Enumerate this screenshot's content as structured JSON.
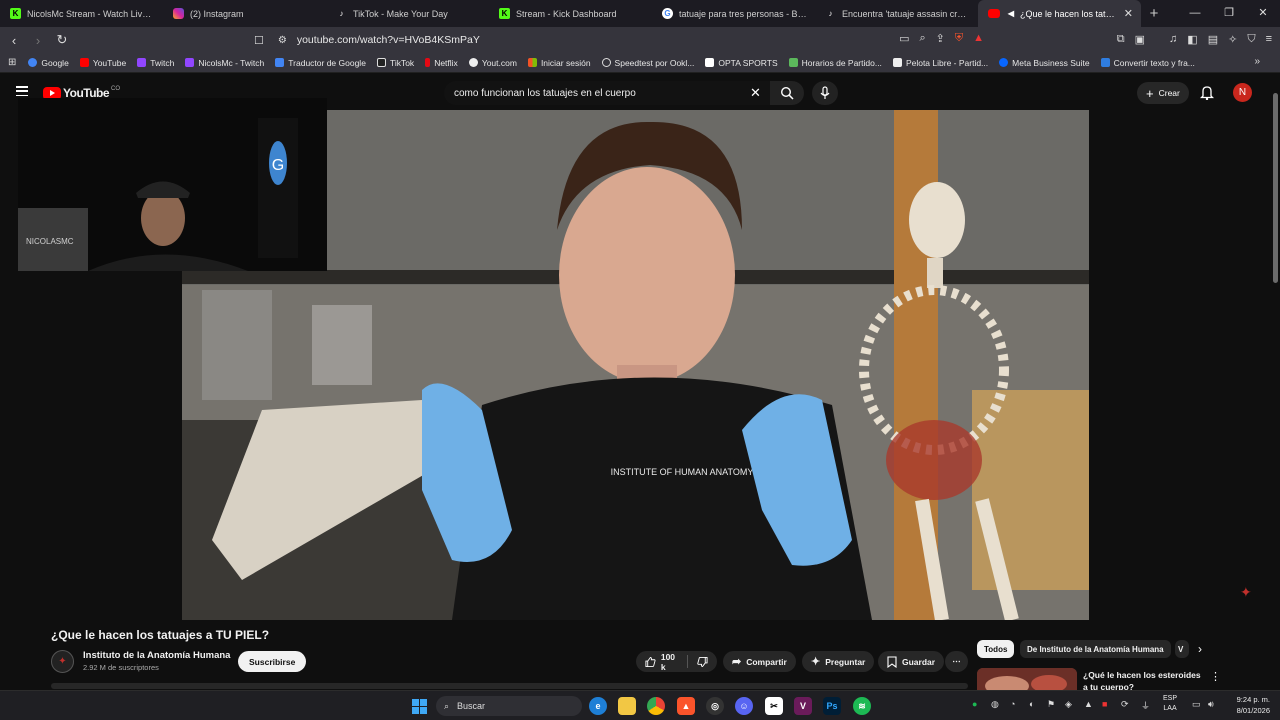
{
  "browser": {
    "tabs": [
      {
        "label": "NicolsMc Stream - Watch Live on Ki",
        "favicon": "kick-icon",
        "color": "#53fc18"
      },
      {
        "label": "(2) Instagram",
        "favicon": "instagram-icon",
        "color": "#d6249f"
      },
      {
        "label": "TikTok - Make Your Day",
        "favicon": "tiktok-icon",
        "color": "#ffffff"
      },
      {
        "label": "Stream - Kick Dashboard",
        "favicon": "kick-icon",
        "color": "#53fc18"
      },
      {
        "label": "tatuaje para tres personas - Buscar c",
        "favicon": "google-icon",
        "color": "#ffffff"
      },
      {
        "label": "Encuentra 'tatuaje assasin cred' en Ti",
        "favicon": "tiktok-icon",
        "color": "#ffffff"
      },
      {
        "label": "¿Que le hacen los tatuajes a",
        "favicon": "youtube-icon",
        "color": "#ff0000",
        "active": true
      }
    ],
    "url": "youtube.com/watch?v=HVoB4KSmPaY",
    "bookmarks": [
      {
        "label": "Google",
        "color": "#4285f4"
      },
      {
        "label": "YouTube",
        "color": "#ff0000"
      },
      {
        "label": "Twitch",
        "color": "#9146ff"
      },
      {
        "label": "NicolsMc - Twitch",
        "color": "#9146ff"
      },
      {
        "label": "Traductor de Google",
        "color": "#4285f4"
      },
      {
        "label": "TikTok",
        "color": "#ffffff"
      },
      {
        "label": "Netflix",
        "color": "#e50914"
      },
      {
        "label": "Yout.com",
        "color": "#ffffff"
      },
      {
        "label": "Iniciar sesión",
        "color": "#f35325"
      },
      {
        "label": "Speedtest por Ookl...",
        "color": "#ffffff"
      },
      {
        "label": "OPTA SPORTS",
        "color": "#ffffff"
      },
      {
        "label": "Horarios de Partido...",
        "color": "#5cb85c"
      },
      {
        "label": "Pelota Libre - Partid...",
        "color": "#ffffff"
      },
      {
        "label": "Meta Business Suite",
        "color": "#0866ff"
      },
      {
        "label": "Convertir texto y fra...",
        "color": "#2f7de1"
      }
    ]
  },
  "youtube": {
    "logo_text": "YouTube",
    "country_code": "CO",
    "search_query": "como funcionan los tatuajes en el cuerpo",
    "create_label": "Crear",
    "avatar_letter": "N",
    "overlay_cam_text": "NICOLASMC",
    "video": {
      "shirt_text": "INSTITUTE OF HUMAN ANATOMY",
      "title": "¿Que le hacen los tatuajes a TU PIEL?",
      "channel_name": "Instituto de la Anatomía Humana",
      "subscribers": "2.92 M de suscriptores",
      "subscribe_label": "Suscribirse",
      "likes": "100 k",
      "share_label": "Compartir",
      "ask_label": "Preguntar",
      "save_label": "Guardar"
    },
    "chips": [
      "Todos",
      "De Instituto de la Anatomía Humana",
      "V"
    ],
    "recommendation": {
      "title": "¿Qué le hacen los esteroides a tu cuerpo?"
    }
  },
  "taskbar": {
    "search_placeholder": "Buscar",
    "language": "ESP",
    "region": "LAA",
    "time": "9:24 p. m.",
    "date": "8/01/2026"
  }
}
